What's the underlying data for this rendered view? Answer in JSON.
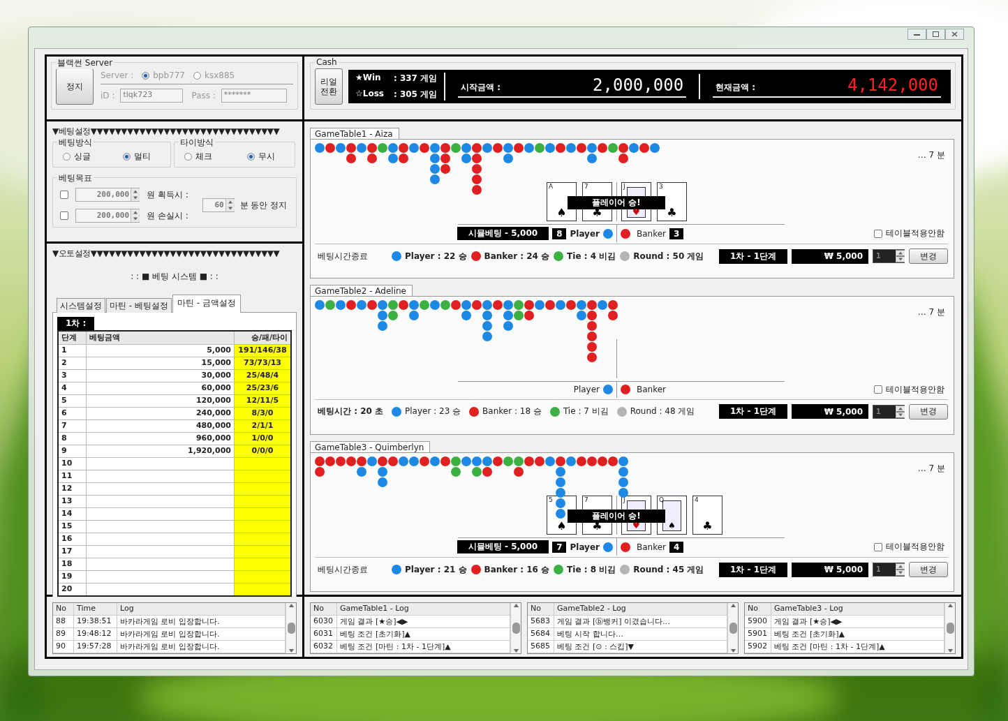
{
  "server": {
    "legend": "블랙썬 Server",
    "stop_button": "정지",
    "server_label": "Server :",
    "servers": [
      {
        "label": "bpb777",
        "selected": true
      },
      {
        "label": "ksx885",
        "selected": false
      }
    ],
    "id_label": "iD :",
    "id_value": "tlqk723",
    "pass_label": "Pass :",
    "pass_value": "*******"
  },
  "betting": {
    "header": "▼베팅설정▼▼▼▼▼▼▼▼▼▼▼▼▼▼▼▼▼▼▼▼▼▼▼▼▼▼▼▼▼▼▼",
    "method": {
      "legend": "베팅방식",
      "options": [
        {
          "label": "싱글",
          "selected": false
        },
        {
          "label": "멀티",
          "selected": true
        }
      ]
    },
    "tie": {
      "legend": "타이방식",
      "options": [
        {
          "label": "체크",
          "selected": false
        },
        {
          "label": "무시",
          "selected": true
        }
      ]
    },
    "target": {
      "legend": "베팅목표",
      "rows": [
        {
          "checked": false,
          "value": "200,000",
          "label": "원 획득시 :"
        },
        {
          "checked": false,
          "value": "200,000",
          "label": "원 손실시 :"
        }
      ],
      "pause_value": "60",
      "pause_label": "분 동안 정지"
    }
  },
  "auto": {
    "header": "▼오토설정▼▼▼▼▼▼▼▼▼▼▼▼▼▼▼▼▼▼▼▼▼▼▼▼▼▼▼▼▼▼▼",
    "system_title": ": : ■ 베팅 시스템 ■ : :",
    "tabs": [
      {
        "label": "시스템설정",
        "selected": false
      },
      {
        "label": "마틴 - 베팅설정",
        "selected": false
      },
      {
        "label": "마틴 - 금액설정",
        "selected": true
      }
    ],
    "round_label": "1차 :",
    "columns": [
      "단계",
      "베팅금액",
      "승/패/타이"
    ],
    "rows": [
      {
        "step": "1",
        "amount": "5,000",
        "result": "191/146/38"
      },
      {
        "step": "2",
        "amount": "15,000",
        "result": "73/73/13"
      },
      {
        "step": "3",
        "amount": "30,000",
        "result": "25/48/4"
      },
      {
        "step": "4",
        "amount": "60,000",
        "result": "25/23/6"
      },
      {
        "step": "5",
        "amount": "120,000",
        "result": "12/11/5"
      },
      {
        "step": "6",
        "amount": "240,000",
        "result": "8/3/0"
      },
      {
        "step": "7",
        "amount": "480,000",
        "result": "2/1/1"
      },
      {
        "step": "8",
        "amount": "960,000",
        "result": "1/0/0"
      },
      {
        "step": "9",
        "amount": "1,920,000",
        "result": "0/0/0"
      },
      {
        "step": "10"
      },
      {
        "step": "11"
      },
      {
        "step": "12"
      },
      {
        "step": "13"
      },
      {
        "step": "14"
      },
      {
        "step": "15"
      },
      {
        "step": "16"
      },
      {
        "step": "17"
      },
      {
        "step": "18"
      },
      {
        "step": "19"
      },
      {
        "step": "20"
      }
    ]
  },
  "cash": {
    "legend": "Cash",
    "switch_button": "리얼 전환",
    "win": "★Win",
    "win_value": ": 337 게임",
    "loss": "☆Loss",
    "loss_value": ": 305 게임",
    "start_label": "시작금액 :",
    "start_value": "2,000,000",
    "current_label": "현재금액 :",
    "current_value": "4,142,000"
  },
  "tables": [
    {
      "tab": "GameTable1 - Aiza",
      "time": "… 7 분",
      "road": [
        [
          {
            "color": "#1e88e5"
          }
        ],
        [
          {
            "color": "#e02020"
          }
        ],
        [
          {
            "color": "#1e88e5"
          }
        ],
        [
          {
            "color": "#e02020"
          },
          {
            "color": "#e02020"
          }
        ],
        [
          {
            "color": "#1e88e5"
          }
        ],
        [
          {
            "color": "#e02020"
          },
          {
            "color": "#e02020"
          }
        ],
        [
          {
            "color": "#3cb043"
          }
        ],
        [
          {
            "color": "#1e88e5"
          },
          {
            "color": "#1e88e5"
          }
        ],
        [
          {
            "color": "#e02020"
          },
          {
            "color": "#e02020"
          }
        ],
        [
          {
            "color": "#1e88e5"
          }
        ],
        [
          {
            "color": "#e02020"
          }
        ],
        [
          {
            "color": "#1e88e5"
          },
          {
            "color": "#1e88e5"
          },
          {
            "color": "#1e88e5"
          },
          {
            "color": "#1e88e5"
          }
        ],
        [
          {
            "color": "#e02020"
          },
          {
            "color": "#e02020"
          },
          {
            "color": "#e02020"
          }
        ],
        [
          {
            "color": "#3cb043"
          }
        ],
        [
          {
            "color": "#1e88e5"
          },
          {
            "color": "#1e88e5"
          }
        ],
        [
          {
            "color": "#e02020"
          },
          {
            "color": "#e02020"
          },
          {
            "color": "#e02020"
          },
          {
            "color": "#e02020"
          },
          {
            "color": "#e02020"
          }
        ],
        [
          {
            "color": "#1e88e5"
          }
        ],
        [
          {
            "color": "#e02020"
          }
        ],
        [
          {
            "color": "#1e88e5"
          },
          {
            "color": "#1e88e5"
          }
        ],
        [
          {
            "color": "#e02020"
          }
        ],
        [
          {
            "color": "#1e88e5"
          }
        ],
        [
          {
            "color": "#3cb043"
          }
        ],
        [
          {
            "color": "#1e88e5"
          }
        ],
        [
          {
            "color": "#e02020"
          }
        ],
        [
          {
            "color": "#1e88e5"
          }
        ],
        [
          {
            "color": "#e02020"
          }
        ],
        [
          {
            "color": "#1e88e5"
          },
          {
            "color": "#1e88e5"
          }
        ],
        [
          {
            "color": "#e02020"
          }
        ],
        [
          {
            "color": "#3cb043"
          }
        ],
        [
          {
            "color": "#e02020"
          },
          {
            "color": "#e02020"
          }
        ],
        [
          {
            "color": "#1e88e5"
          }
        ],
        [
          {
            "color": "#e02020"
          }
        ],
        [
          {
            "color": "#1e88e5"
          }
        ]
      ],
      "player_cards": [
        {
          "rank": "A",
          "suit": "♠",
          "face": false
        },
        {
          "rank": "7",
          "suit": "♣",
          "face": false
        }
      ],
      "banker_cards": [
        {
          "rank": "J",
          "suit": "♥",
          "face": true
        },
        {
          "rank": "3",
          "suit": "♣",
          "face": false
        }
      ],
      "result": "플레이어 승!",
      "bar": {
        "sim": "시뮬베팅 - 5,000",
        "player_count": "8",
        "player": "Player",
        "player_bold": true,
        "banker": "Banker",
        "banker_count": "3"
      },
      "table_option": {
        "label": "테이블적용안함",
        "checked": false
      },
      "timer": "베팅시간종료",
      "timer_bold": false,
      "stats_bold": true,
      "stats": [
        {
          "text": "Player : 22 승",
          "color": "#1e88e5"
        },
        {
          "text": "Banker : 24 승",
          "color": "#e02020"
        },
        {
          "text": "Tie : 4 비김",
          "color": "#3cb043"
        },
        {
          "text": "Round : 50 게임",
          "color": "#b4b4b4"
        }
      ],
      "stage": "1차 - 1단계",
      "amount": "₩ 5,000",
      "spinner": "1",
      "change_button": "변경"
    },
    {
      "tab": "GameTable2 - Adeline",
      "time": "… 7 분",
      "road": [
        [
          {
            "color": "#1e88e5"
          }
        ],
        [
          {
            "color": "#3cb043"
          }
        ],
        [
          {
            "color": "#1e88e5"
          }
        ],
        [
          {
            "color": "#e02020"
          }
        ],
        [
          {
            "color": "#1e88e5"
          }
        ],
        [
          {
            "color": "#e02020"
          }
        ],
        [
          {
            "color": "#1e88e5"
          },
          {
            "color": "#1e88e5"
          },
          {
            "color": "#1e88e5"
          }
        ],
        [
          {
            "color": "#3cb043"
          },
          {
            "color": "#3cb043"
          }
        ],
        [
          {
            "color": "#e02020"
          }
        ],
        [
          {
            "color": "#1e88e5"
          },
          {
            "color": "#1e88e5"
          }
        ],
        [
          {
            "color": "#3cb043"
          }
        ],
        [
          {
            "color": "#1e88e5"
          }
        ],
        [
          {
            "color": "#3cb043"
          }
        ],
        [
          {
            "color": "#e02020"
          }
        ],
        [
          {
            "color": "#1e88e5"
          },
          {
            "color": "#1e88e5"
          }
        ],
        [
          {
            "color": "#e02020"
          }
        ],
        [
          {
            "color": "#1e88e5"
          },
          {
            "color": "#1e88e5"
          },
          {
            "color": "#1e88e5"
          },
          {
            "color": "#1e88e5"
          }
        ],
        [
          {
            "color": "#e02020"
          }
        ],
        [
          {
            "color": "#1e88e5"
          },
          {
            "color": "#1e88e5"
          },
          {
            "color": "#1e88e5"
          }
        ],
        [
          {
            "color": "#3cb043"
          },
          {
            "color": "#3cb043"
          }
        ],
        [
          {
            "color": "#e02020"
          },
          {
            "color": "#e02020"
          }
        ],
        [
          {
            "color": "#1e88e5"
          }
        ],
        [
          {
            "color": "#e02020"
          }
        ],
        [
          {
            "color": "#1e88e5"
          }
        ],
        [
          {
            "color": "#e02020"
          }
        ],
        [
          {
            "color": "#1e88e5"
          },
          {
            "color": "#1e88e5"
          }
        ],
        [
          {
            "color": "#e02020"
          },
          {
            "color": "#e02020"
          },
          {
            "color": "#e02020"
          },
          {
            "color": "#e02020"
          },
          {
            "color": "#e02020"
          },
          {
            "color": "#e02020"
          }
        ],
        [
          {
            "color": "#1e88e5"
          }
        ],
        [
          {
            "color": "#e02020"
          },
          {
            "color": "#e02020"
          }
        ]
      ],
      "bar": {
        "player": "Player",
        "player_bold": false,
        "banker": "Banker"
      },
      "table_option": {
        "label": "테이블적용안함",
        "checked": false
      },
      "timer": "베팅시간 : 20 초",
      "timer_bold": true,
      "stats_bold": false,
      "stats": [
        {
          "text": "Player : 23 승",
          "color": "#1e88e5"
        },
        {
          "text": "Banker : 18 승",
          "color": "#e02020"
        },
        {
          "text": "Tie : 7 비김",
          "color": "#3cb043"
        },
        {
          "text": "Round : 48 게임",
          "color": "#b4b4b4"
        }
      ],
      "stage": "1차 - 1단계",
      "amount": "₩ 5,000",
      "spinner": "1",
      "change_button": "변경"
    },
    {
      "tab": "GameTable3 - Quimberlyn",
      "time": "… 7 분",
      "road": [
        [
          {
            "color": "#e02020"
          },
          {
            "color": "#e02020"
          }
        ],
        [
          {
            "color": "#e02020"
          }
        ],
        [
          {
            "color": "#e02020"
          }
        ],
        [
          {
            "color": "#e02020"
          }
        ],
        [
          {
            "color": "#e02020"
          },
          {
            "color": "#1e88e5"
          }
        ],
        [
          {
            "color": "#1e88e5"
          }
        ],
        [
          {
            "color": "#e02020"
          },
          {
            "color": "#1e88e5"
          },
          {
            "color": "#1e88e5"
          }
        ],
        [
          {
            "color": "#e02020"
          }
        ],
        [
          {
            "color": "#1e88e5"
          }
        ],
        [
          {
            "color": "#1e88e5"
          }
        ],
        [
          {
            "color": "#e02020"
          }
        ],
        [
          {
            "color": "#1e88e5"
          }
        ],
        [
          {
            "color": "#e02020"
          }
        ],
        [
          {
            "color": "#3cb043"
          },
          {
            "color": "#3cb043"
          }
        ],
        [
          {
            "color": "#1e88e5"
          }
        ],
        [
          {
            "color": "#1e88e5"
          },
          {
            "color": "#3cb043"
          }
        ],
        [
          {
            "color": "#1e88e5"
          },
          {
            "color": "#e02020"
          }
        ],
        [
          {
            "color": "#e02020"
          }
        ],
        [
          {
            "color": "#3cb043"
          }
        ],
        [
          {
            "color": "#3cb043"
          },
          {
            "color": "#e02020"
          }
        ],
        [
          {
            "color": "#e02020"
          }
        ],
        [
          {
            "color": "#e02020"
          }
        ],
        [
          {
            "color": "#1e88e5"
          }
        ],
        [
          {
            "color": "#e02020"
          },
          {
            "color": "#1e88e5"
          },
          {
            "color": "#1e88e5"
          },
          {
            "color": "#1e88e5"
          },
          {
            "color": "#1e88e5"
          },
          {
            "color": "#1e88e5"
          }
        ],
        [
          {
            "color": "#1e88e5"
          }
        ],
        [
          {
            "color": "#e02020"
          }
        ],
        [
          {
            "color": "#e02020"
          }
        ],
        [
          {
            "color": "#e02020"
          }
        ],
        [
          {
            "color": "#e02020"
          }
        ],
        [
          {
            "color": "#1e88e5"
          },
          {
            "color": "#1e88e5"
          },
          {
            "color": "#1e88e5"
          },
          {
            "color": "#1e88e5"
          }
        ]
      ],
      "player_cards": [
        {
          "rank": "5",
          "suit": "♠",
          "face": false
        },
        {
          "rank": "7",
          "suit": "♣",
          "face": false
        }
      ],
      "banker_cards": [
        {
          "rank": "J",
          "suit": "♥",
          "face": true
        },
        {
          "rank": "Q",
          "suit": "♠",
          "face": true
        },
        {
          "rank": "4",
          "suit": "♣",
          "face": false
        }
      ],
      "result": "플레이어 승!",
      "bar": {
        "sim": "시뮬베팅 - 5,000",
        "player_count": "7",
        "player": "Player",
        "player_bold": true,
        "banker": "Banker",
        "banker_count": "4"
      },
      "table_option": {
        "label": "테이블적용안함",
        "checked": false
      },
      "timer": "베팅시간종료",
      "timer_bold": false,
      "stats_bold": true,
      "stats": [
        {
          "text": "Player : 21 승",
          "color": "#1e88e5"
        },
        {
          "text": "Banker : 16 승",
          "color": "#e02020"
        },
        {
          "text": "Tie : 8 비김",
          "color": "#3cb043"
        },
        {
          "text": "Round : 45 게임",
          "color": "#b4b4b4"
        }
      ],
      "stage": "1차 - 1단계",
      "amount": "₩ 5,000",
      "spinner": "1",
      "change_button": "변경"
    }
  ],
  "logs": [
    {
      "columns": [
        "No",
        "Time",
        "Log"
      ],
      "rows": [
        [
          "88",
          "19:38:51",
          "바카라게임 로비 입장합니다."
        ],
        [
          "89",
          "19:48:12",
          "바카라게임 로비 입장합니다."
        ],
        [
          "90",
          "19:57:28",
          "바카라게임 로비 입장합니다."
        ]
      ]
    },
    {
      "columns": [
        "No",
        "GameTable1 - Log"
      ],
      "rows": [
        [
          "6030",
          "게임 결과 [★승]◀▶"
        ],
        [
          "6031",
          "베팅 조건 [초기화]▲"
        ],
        [
          "6032",
          "베팅 조건 [마틴 : 1차 - 1단계]▲"
        ]
      ]
    },
    {
      "columns": [
        "No",
        "GameTable2 - Log"
      ],
      "rows": [
        [
          "5683",
          "게임 결과 [ⓑ뱅커] 이겼습니다…"
        ],
        [
          "5684",
          "베팅 시작 합니다…"
        ],
        [
          "5685",
          "베팅 조건 [⊙ : 스킵]▼"
        ]
      ]
    },
    {
      "columns": [
        "No",
        "GameTable3 - Log"
      ],
      "rows": [
        [
          "5900",
          "게임 결과 [★승]◀▶"
        ],
        [
          "5901",
          "베팅 조건 [초기화]▲"
        ],
        [
          "5902",
          "베팅 조건 [마틴 : 1차 - 1단계]▲"
        ]
      ]
    }
  ]
}
